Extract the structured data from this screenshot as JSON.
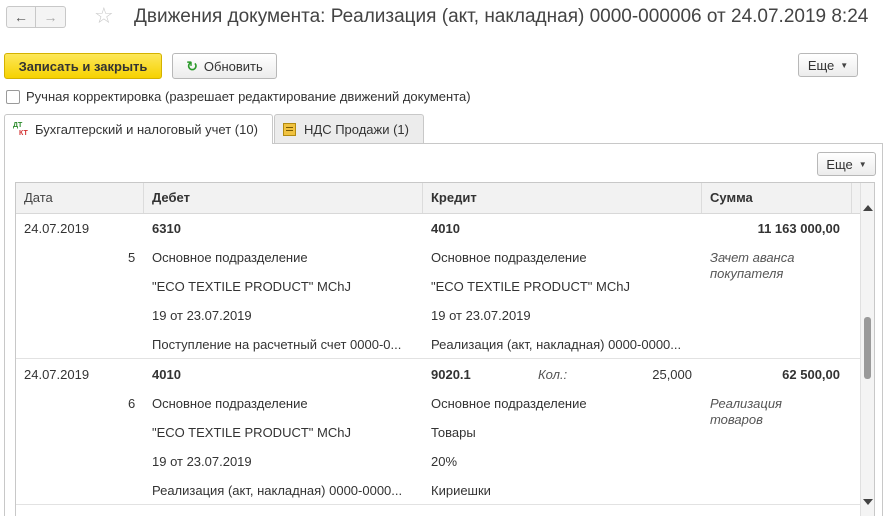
{
  "window": {
    "title": "Движения документа: Реализация (акт, накладная) 0000-000006 от 24.07.2019 8:24",
    "back_icon": "arrow-left-icon",
    "forward_icon": "arrow-right-icon",
    "favorite_icon": "star-icon"
  },
  "toolbar": {
    "save_close_label": "Записать и закрыть",
    "refresh_label": "Обновить",
    "more_label": "Еще"
  },
  "manual_correction": {
    "label": "Ручная корректировка (разрешает редактирование движений документа)",
    "checked": false
  },
  "tabs": [
    {
      "label": "Бухгалтерский и налоговый учет (10)",
      "active": true,
      "icon": "dt-kt-icon"
    },
    {
      "label": "НДС Продажи (1)",
      "active": false,
      "icon": "register-icon"
    }
  ],
  "grid": {
    "more_label": "Еще",
    "columns": [
      "Дата",
      "Дебет",
      "Кредит",
      "Сумма"
    ],
    "rows": [
      {
        "date": "24.07.2019",
        "num": "5",
        "debit": [
          "6310",
          "Основное подразделение",
          "\"ECO TEXTILE PRODUCT\" MChJ",
          "19 от 23.07.2019",
          "Поступление на расчетный счет 0000-0..."
        ],
        "credit": [
          "4010",
          "Основное подразделение",
          "\"ECO TEXTILE PRODUCT\" MChJ",
          "19 от 23.07.2019",
          "Реализация (акт, накладная) 0000-0000..."
        ],
        "qty_label": "",
        "qty": "",
        "sum": "11 163 000,00",
        "comment": "Зачет аванса покупателя"
      },
      {
        "date": "24.07.2019",
        "num": "6",
        "debit": [
          "4010",
          "Основное подразделение",
          "\"ECO TEXTILE PRODUCT\" MChJ",
          "19 от 23.07.2019",
          "Реализация (акт, накладная) 0000-0000..."
        ],
        "credit": [
          "9020.1",
          "Основное подразделение",
          "Товары",
          "20%",
          "Кириешки"
        ],
        "qty_label": "Кол.:",
        "qty": "25,000",
        "sum": "62 500,00",
        "comment": "Реализация товаров"
      }
    ]
  },
  "colors": {
    "primary_button": "#f6d200",
    "refresh_icon": "#2b9a2b"
  }
}
